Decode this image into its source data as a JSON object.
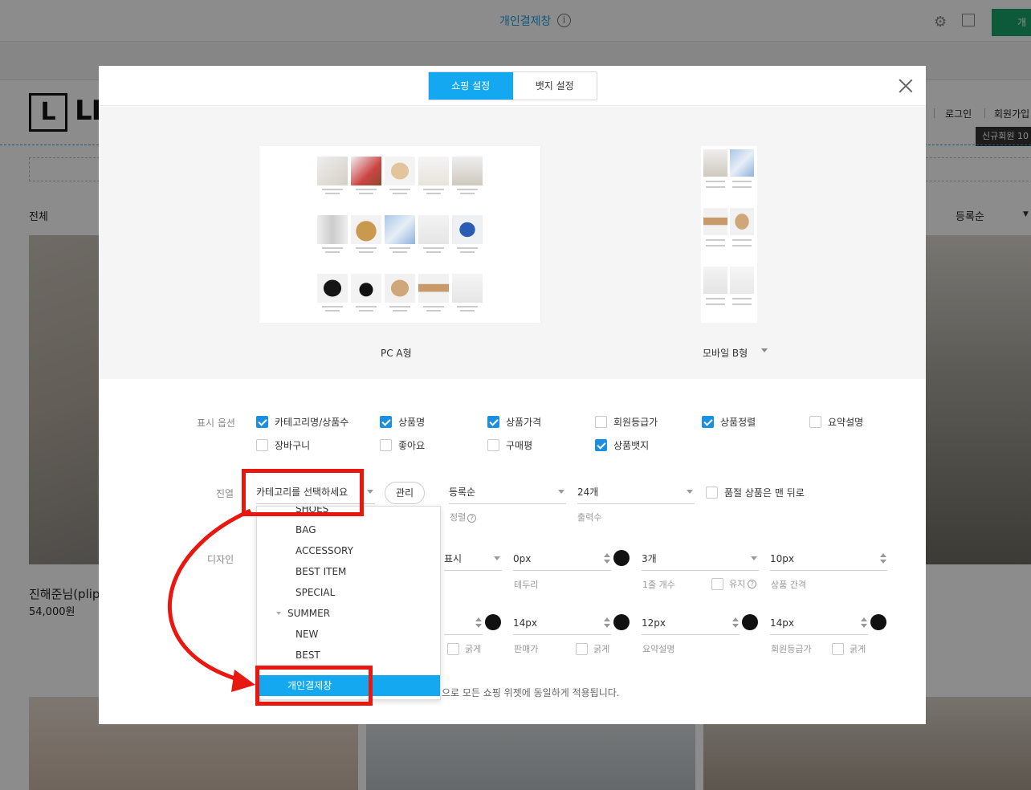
{
  "background": {
    "title": "개인결제창",
    "top_action": "개",
    "logo_letter": "L",
    "logo_text": "LIN",
    "category_label": "전체",
    "sort_label": "등록순",
    "login": "로그인",
    "join": "회원가입",
    "tooltip": "신규회원 10",
    "product_name": "진해준님(plip",
    "product_price": "54,000원"
  },
  "modal": {
    "tabs": [
      {
        "label": "쇼핑 설정",
        "active": true
      },
      {
        "label": "뱃지 설정",
        "active": false
      }
    ],
    "preview": {
      "pc_label": "PC A형",
      "mobile_label": "모바일 B형"
    },
    "display_options": {
      "label": "표시 옵션",
      "items": [
        {
          "label": "카테고리명/상품수",
          "checked": true
        },
        {
          "label": "상품명",
          "checked": true
        },
        {
          "label": "상품가격",
          "checked": true
        },
        {
          "label": "회원등급가",
          "checked": false
        },
        {
          "label": "상품정렬",
          "checked": true
        },
        {
          "label": "요약설명",
          "checked": false
        },
        {
          "label": "장바구니",
          "checked": false
        },
        {
          "label": "좋아요",
          "checked": false
        },
        {
          "label": "구매평",
          "checked": false
        },
        {
          "label": "상품뱃지",
          "checked": true
        }
      ]
    },
    "display": {
      "label": "진열",
      "category_value": "카테고리를 선택하세요",
      "manage_label": "관리",
      "sort_value": "등록순",
      "sort_sub": "정렬",
      "count_value": "24개",
      "count_sub": "출력수",
      "soldout_label": "품절 상품은 맨 뒤로"
    },
    "design": {
      "label": "디자인",
      "row1": {
        "show_value": "표시",
        "border_value": "0px",
        "border_sub": "테두리",
        "per_row_value": "3개",
        "per_row_sub": "1줄 개수",
        "keep_label": "유지",
        "gap_value": "10px",
        "gap_sub": "상품 간격"
      },
      "row2": {
        "bold_label": "굵게",
        "seller_size": "14px",
        "seller_sub": "판매가",
        "seller_bold": "굵게",
        "summary_size": "12px",
        "summary_sub": "요약설명",
        "member_size": "14px",
        "member_sub": "회원등급가",
        "member_bold": "굵게"
      }
    },
    "note": "으로 모든 쇼핑 위젯에 동일하게 적용됩니다."
  },
  "dropdown": {
    "items": [
      {
        "label": "SHOES",
        "level": 2,
        "selected": false
      },
      {
        "label": "BAG",
        "level": 2,
        "selected": false
      },
      {
        "label": "ACCESSORY",
        "level": 2,
        "selected": false
      },
      {
        "label": "BEST ITEM",
        "level": 2,
        "selected": false
      },
      {
        "label": "SPECIAL",
        "level": 2,
        "selected": false
      },
      {
        "label": "SUMMER",
        "level": 1,
        "selected": false
      },
      {
        "label": "NEW",
        "level": 2,
        "selected": false
      },
      {
        "label": "BEST",
        "level": 2,
        "selected": false
      },
      {
        "label": "개인결제창",
        "level": 1,
        "selected": true
      }
    ]
  },
  "colors": {
    "accent": "#13a8ef",
    "checkbox": "#1b8fe0",
    "annotation_red": "#e8170f",
    "green_button": "#18a56a"
  }
}
